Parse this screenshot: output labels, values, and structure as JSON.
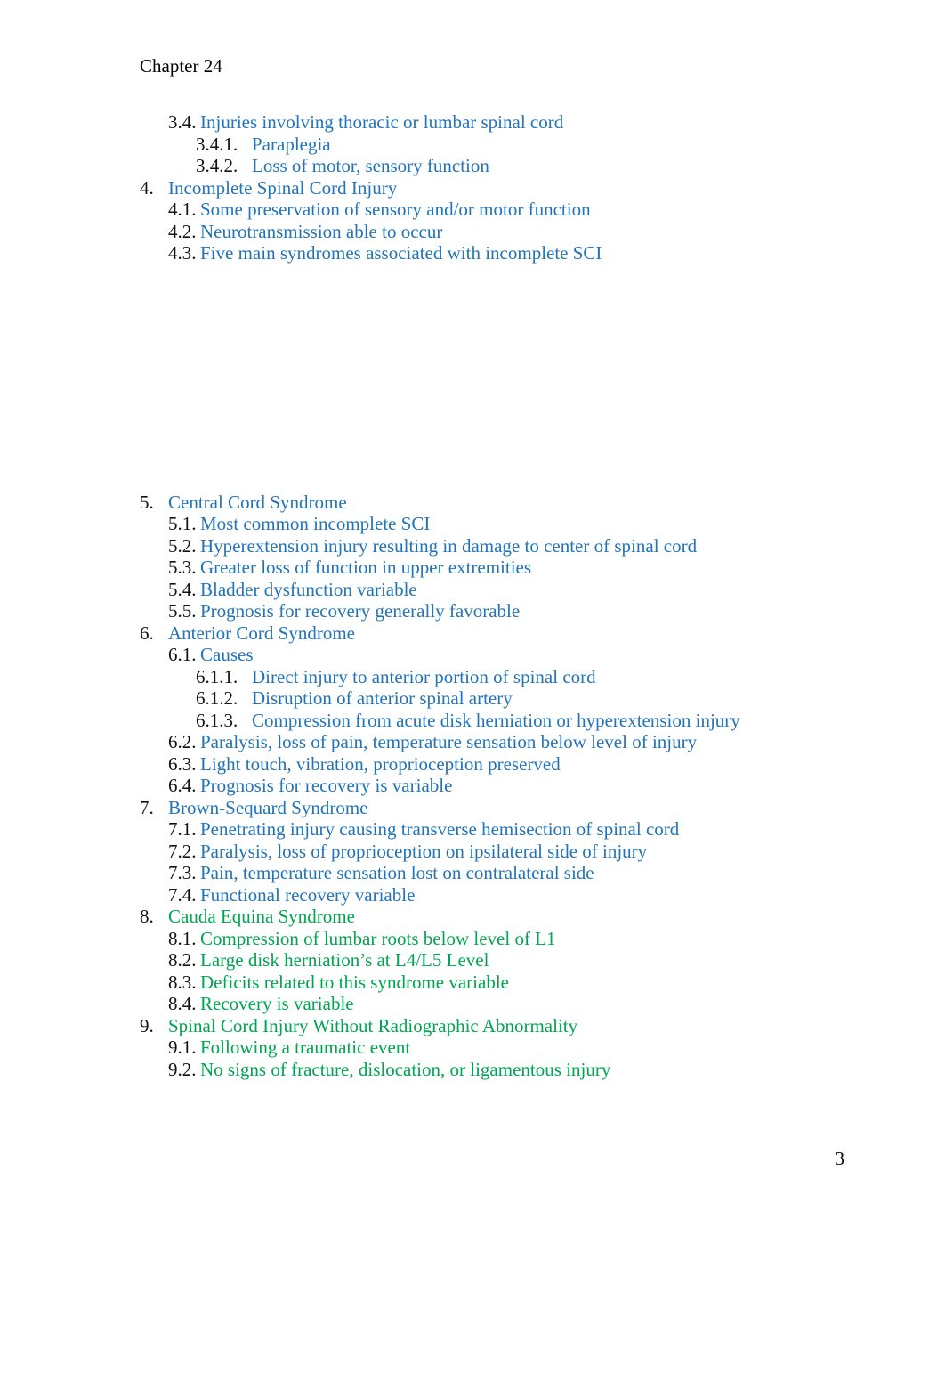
{
  "document": {
    "header": "Chapter 24",
    "page_number": "3",
    "colors": {
      "blue": "#2274B8",
      "green": "#00A551",
      "number_black": "#131313",
      "header_black": "#000000"
    }
  },
  "outline": {
    "group_before_gap": [
      {
        "number": "3.4.",
        "text": "Injuries involving thoracic or lumbar spinal cord",
        "level": 2,
        "color": "blue"
      },
      {
        "number": "3.4.1.",
        "text": "Paraplegia",
        "level": 3,
        "color": "blue"
      },
      {
        "number": "3.4.2.",
        "text": "Loss of motor, sensory function",
        "level": 3,
        "color": "blue"
      },
      {
        "number": "4.",
        "text": "Incomplete Spinal Cord Injury",
        "level": 1,
        "color": "blue"
      },
      {
        "number": "4.1.",
        "text": "Some preservation of sensory and/or motor function",
        "level": 2,
        "color": "blue"
      },
      {
        "number": "4.2.",
        "text": "Neurotransmission able to occur",
        "level": 2,
        "color": "blue"
      },
      {
        "number": "4.3.",
        "text": "Five main syndromes associated with incomplete SCI",
        "level": 2,
        "color": "blue"
      }
    ],
    "group_after_gap": [
      {
        "number": "5.",
        "text": "Central Cord Syndrome",
        "level": 1,
        "color": "blue"
      },
      {
        "number": "5.1.",
        "text": "Most common incomplete SCI",
        "level": 2,
        "color": "blue"
      },
      {
        "number": "5.2.",
        "text": "Hyperextension injury resulting in damage to center of spinal cord",
        "level": 2,
        "color": "blue"
      },
      {
        "number": "5.3.",
        "text": "Greater loss of function in upper extremities",
        "level": 2,
        "color": "blue"
      },
      {
        "number": "5.4.",
        "text": "Bladder dysfunction variable",
        "level": 2,
        "color": "blue"
      },
      {
        "number": "5.5.",
        "text": "Prognosis for recovery generally favorable",
        "level": 2,
        "color": "blue"
      },
      {
        "number": "6.",
        "text": "Anterior Cord Syndrome",
        "level": 1,
        "color": "blue"
      },
      {
        "number": "6.1.",
        "text": "Causes",
        "level": 2,
        "color": "blue"
      },
      {
        "number": "6.1.1.",
        "text": "Direct injury to anterior portion of spinal cord",
        "level": 3,
        "color": "blue"
      },
      {
        "number": "6.1.2.",
        "text": "Disruption of anterior spinal artery",
        "level": 3,
        "color": "blue"
      },
      {
        "number": "6.1.3.",
        "text": "Compression from acute disk herniation or hyperextension injury",
        "level": 3,
        "color": "blue"
      },
      {
        "number": "6.2.",
        "text": "Paralysis, loss of pain, temperature sensation below level of injury",
        "level": 2,
        "color": "blue"
      },
      {
        "number": "6.3.",
        "text": "Light touch, vibration, proprioception preserved",
        "level": 2,
        "color": "blue"
      },
      {
        "number": "6.4.",
        "text": "Prognosis for recovery is variable",
        "level": 2,
        "color": "blue"
      },
      {
        "number": "7.",
        "text": "Brown-Sequard Syndrome",
        "level": 1,
        "color": "blue"
      },
      {
        "number": "7.1.",
        "text": "Penetrating injury causing transverse hemisection of spinal cord",
        "level": 2,
        "color": "blue"
      },
      {
        "number": "7.2.",
        "text": "Paralysis, loss of proprioception on ipsilateral side of injury",
        "level": 2,
        "color": "blue"
      },
      {
        "number": "7.3.",
        "text": "Pain, temperature sensation lost on contralateral side",
        "level": 2,
        "color": "blue"
      },
      {
        "number": "7.4.",
        "text": "Functional recovery variable",
        "level": 2,
        "color": "blue"
      },
      {
        "number": "8.",
        "text": "Cauda Equina Syndrome",
        "level": 1,
        "color": "green"
      },
      {
        "number": "8.1.",
        "text": "Compression of lumbar roots below level of L1",
        "level": 2,
        "color": "green"
      },
      {
        "number": "8.2.",
        "text": "Large disk herniation’s at L4/L5 Level",
        "level": 2,
        "color": "green"
      },
      {
        "number": "8.3.",
        "text": "Deficits related to this syndrome variable",
        "level": 2,
        "color": "green"
      },
      {
        "number": "8.4.",
        "text": "Recovery is variable",
        "level": 2,
        "color": "green"
      },
      {
        "number": "9.",
        "text": "Spinal Cord Injury Without Radiographic Abnormality",
        "level": 1,
        "color": "green"
      },
      {
        "number": "9.1.",
        "text": "Following a traumatic event",
        "level": 2,
        "color": "green"
      },
      {
        "number": "9.2.",
        "text": "No signs of fracture, dislocation, or ligamentous injury",
        "level": 2,
        "color": "green"
      }
    ]
  }
}
